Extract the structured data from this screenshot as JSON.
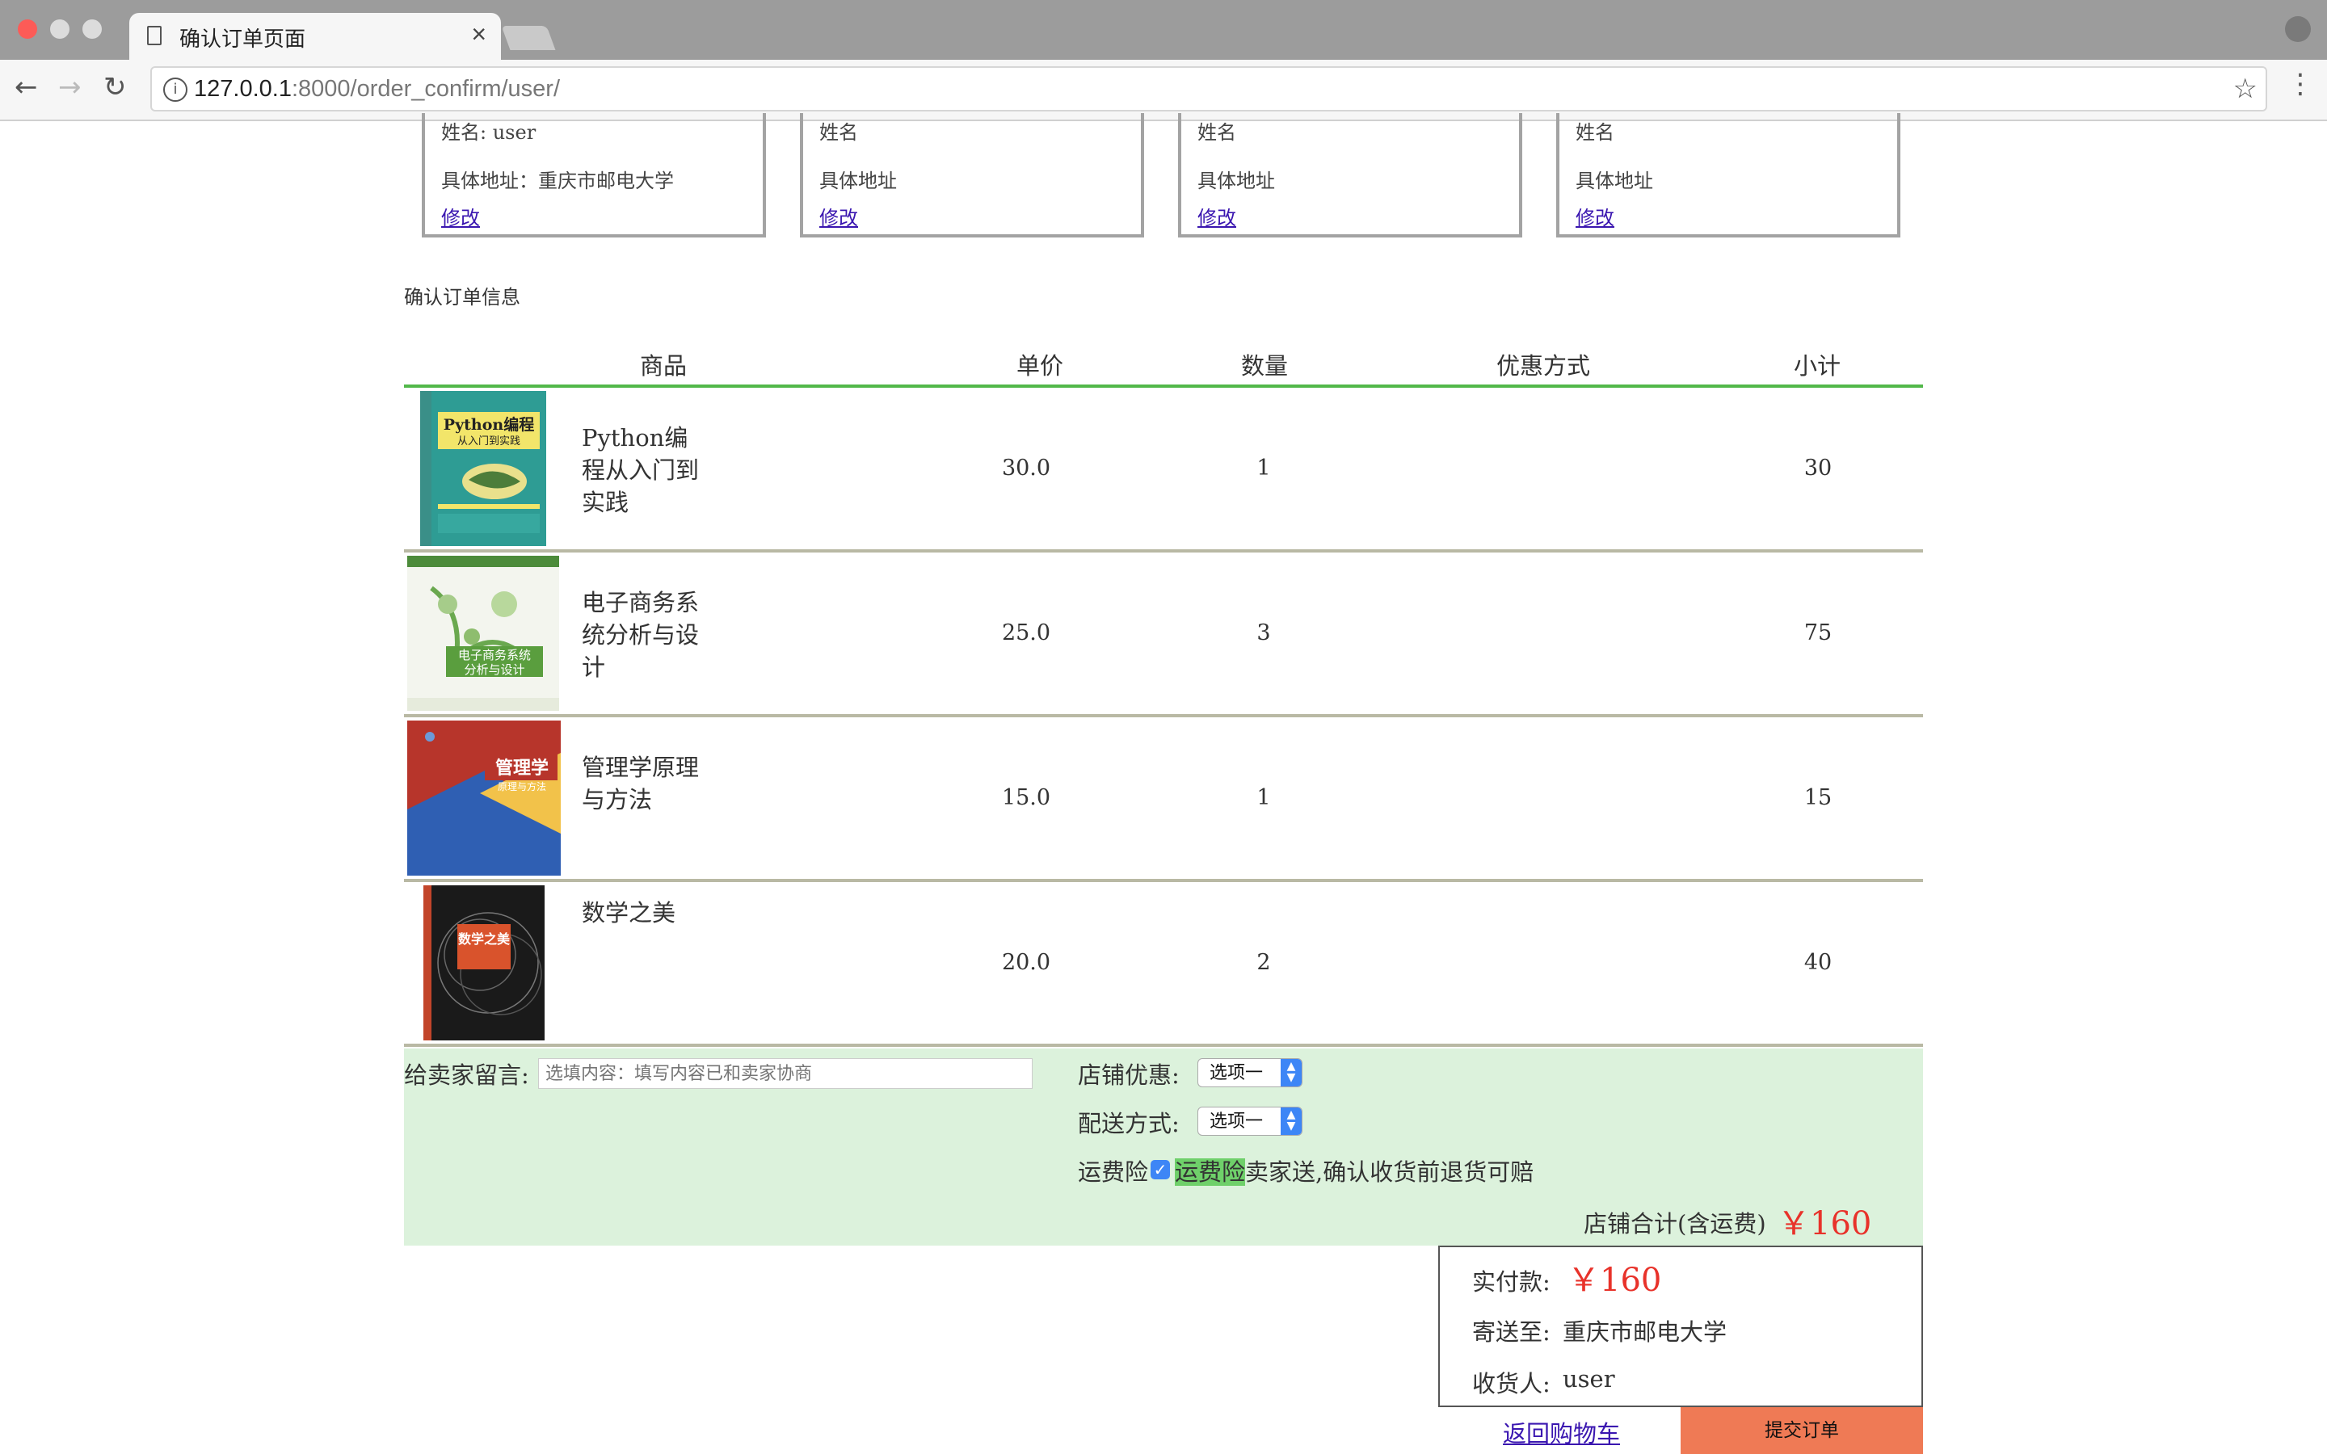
{
  "browser": {
    "tab_title": "确认订单页面",
    "close_glyph": "×",
    "url_host": "127.0.0.1",
    "url_rest": ":8000/order_confirm/user/"
  },
  "address_cards": [
    {
      "name": "姓名: user",
      "address": "具体地址：重庆市邮电大学",
      "edit": "修改"
    },
    {
      "name": "姓名",
      "address": "具体地址",
      "edit": "修改"
    },
    {
      "name": "姓名",
      "address": "具体地址",
      "edit": "修改"
    },
    {
      "name": "姓名",
      "address": "具体地址",
      "edit": "修改"
    }
  ],
  "order": {
    "section_title": "确认订单信息",
    "headers": {
      "product": "商品",
      "price": "单价",
      "qty": "数量",
      "discount": "优惠方式",
      "subtotal": "小计"
    },
    "items": [
      {
        "name": "Python编程从入门到实践",
        "price": "30.0",
        "qty": "1",
        "subtotal": "30",
        "cover_title": "Python编程",
        "cover_sub": "从入门到实践"
      },
      {
        "name": "电子商务系统分析与设计",
        "price": "25.0",
        "qty": "3",
        "subtotal": "75",
        "cover_title": "电子商务系统",
        "cover_sub": "分析与设计"
      },
      {
        "name": "管理学原理与方法",
        "price": "15.0",
        "qty": "1",
        "subtotal": "15",
        "cover_title": "管理学",
        "cover_sub": "原理与方法"
      },
      {
        "name": "数学之美",
        "price": "20.0",
        "qty": "2",
        "subtotal": "40",
        "cover_title": "数学之美",
        "cover_sub": ""
      }
    ]
  },
  "shop": {
    "message_label": "给卖家留言:",
    "message_placeholder": "选填内容：填写内容已和卖家协商",
    "discount_label": "店铺优惠:",
    "discount_value": "选项一",
    "delivery_label": "配送方式:",
    "delivery_value": "选项一",
    "insurance_label": "运费险",
    "insurance_checked": true,
    "insurance_highlight": "运费险",
    "insurance_desc": "卖家送,确认收货前退货可赔",
    "total_label": "店铺合计(含运费)",
    "total_value": "￥160"
  },
  "summary": {
    "paid_label": "实付款:",
    "paid_value": "￥160",
    "ship_to_label": "寄送至:",
    "ship_to_value": "重庆市邮电大学",
    "receiver_label": "收货人:",
    "receiver_value": "user"
  },
  "actions": {
    "back_to_cart": "返回购物车",
    "submit": "提交订单"
  },
  "colors": {
    "header_line": "#52b84a",
    "shop_bg": "#dcf2dc",
    "price_red": "#e8322a",
    "submit_bg": "#ef7a55",
    "link": "#3a16b0"
  }
}
